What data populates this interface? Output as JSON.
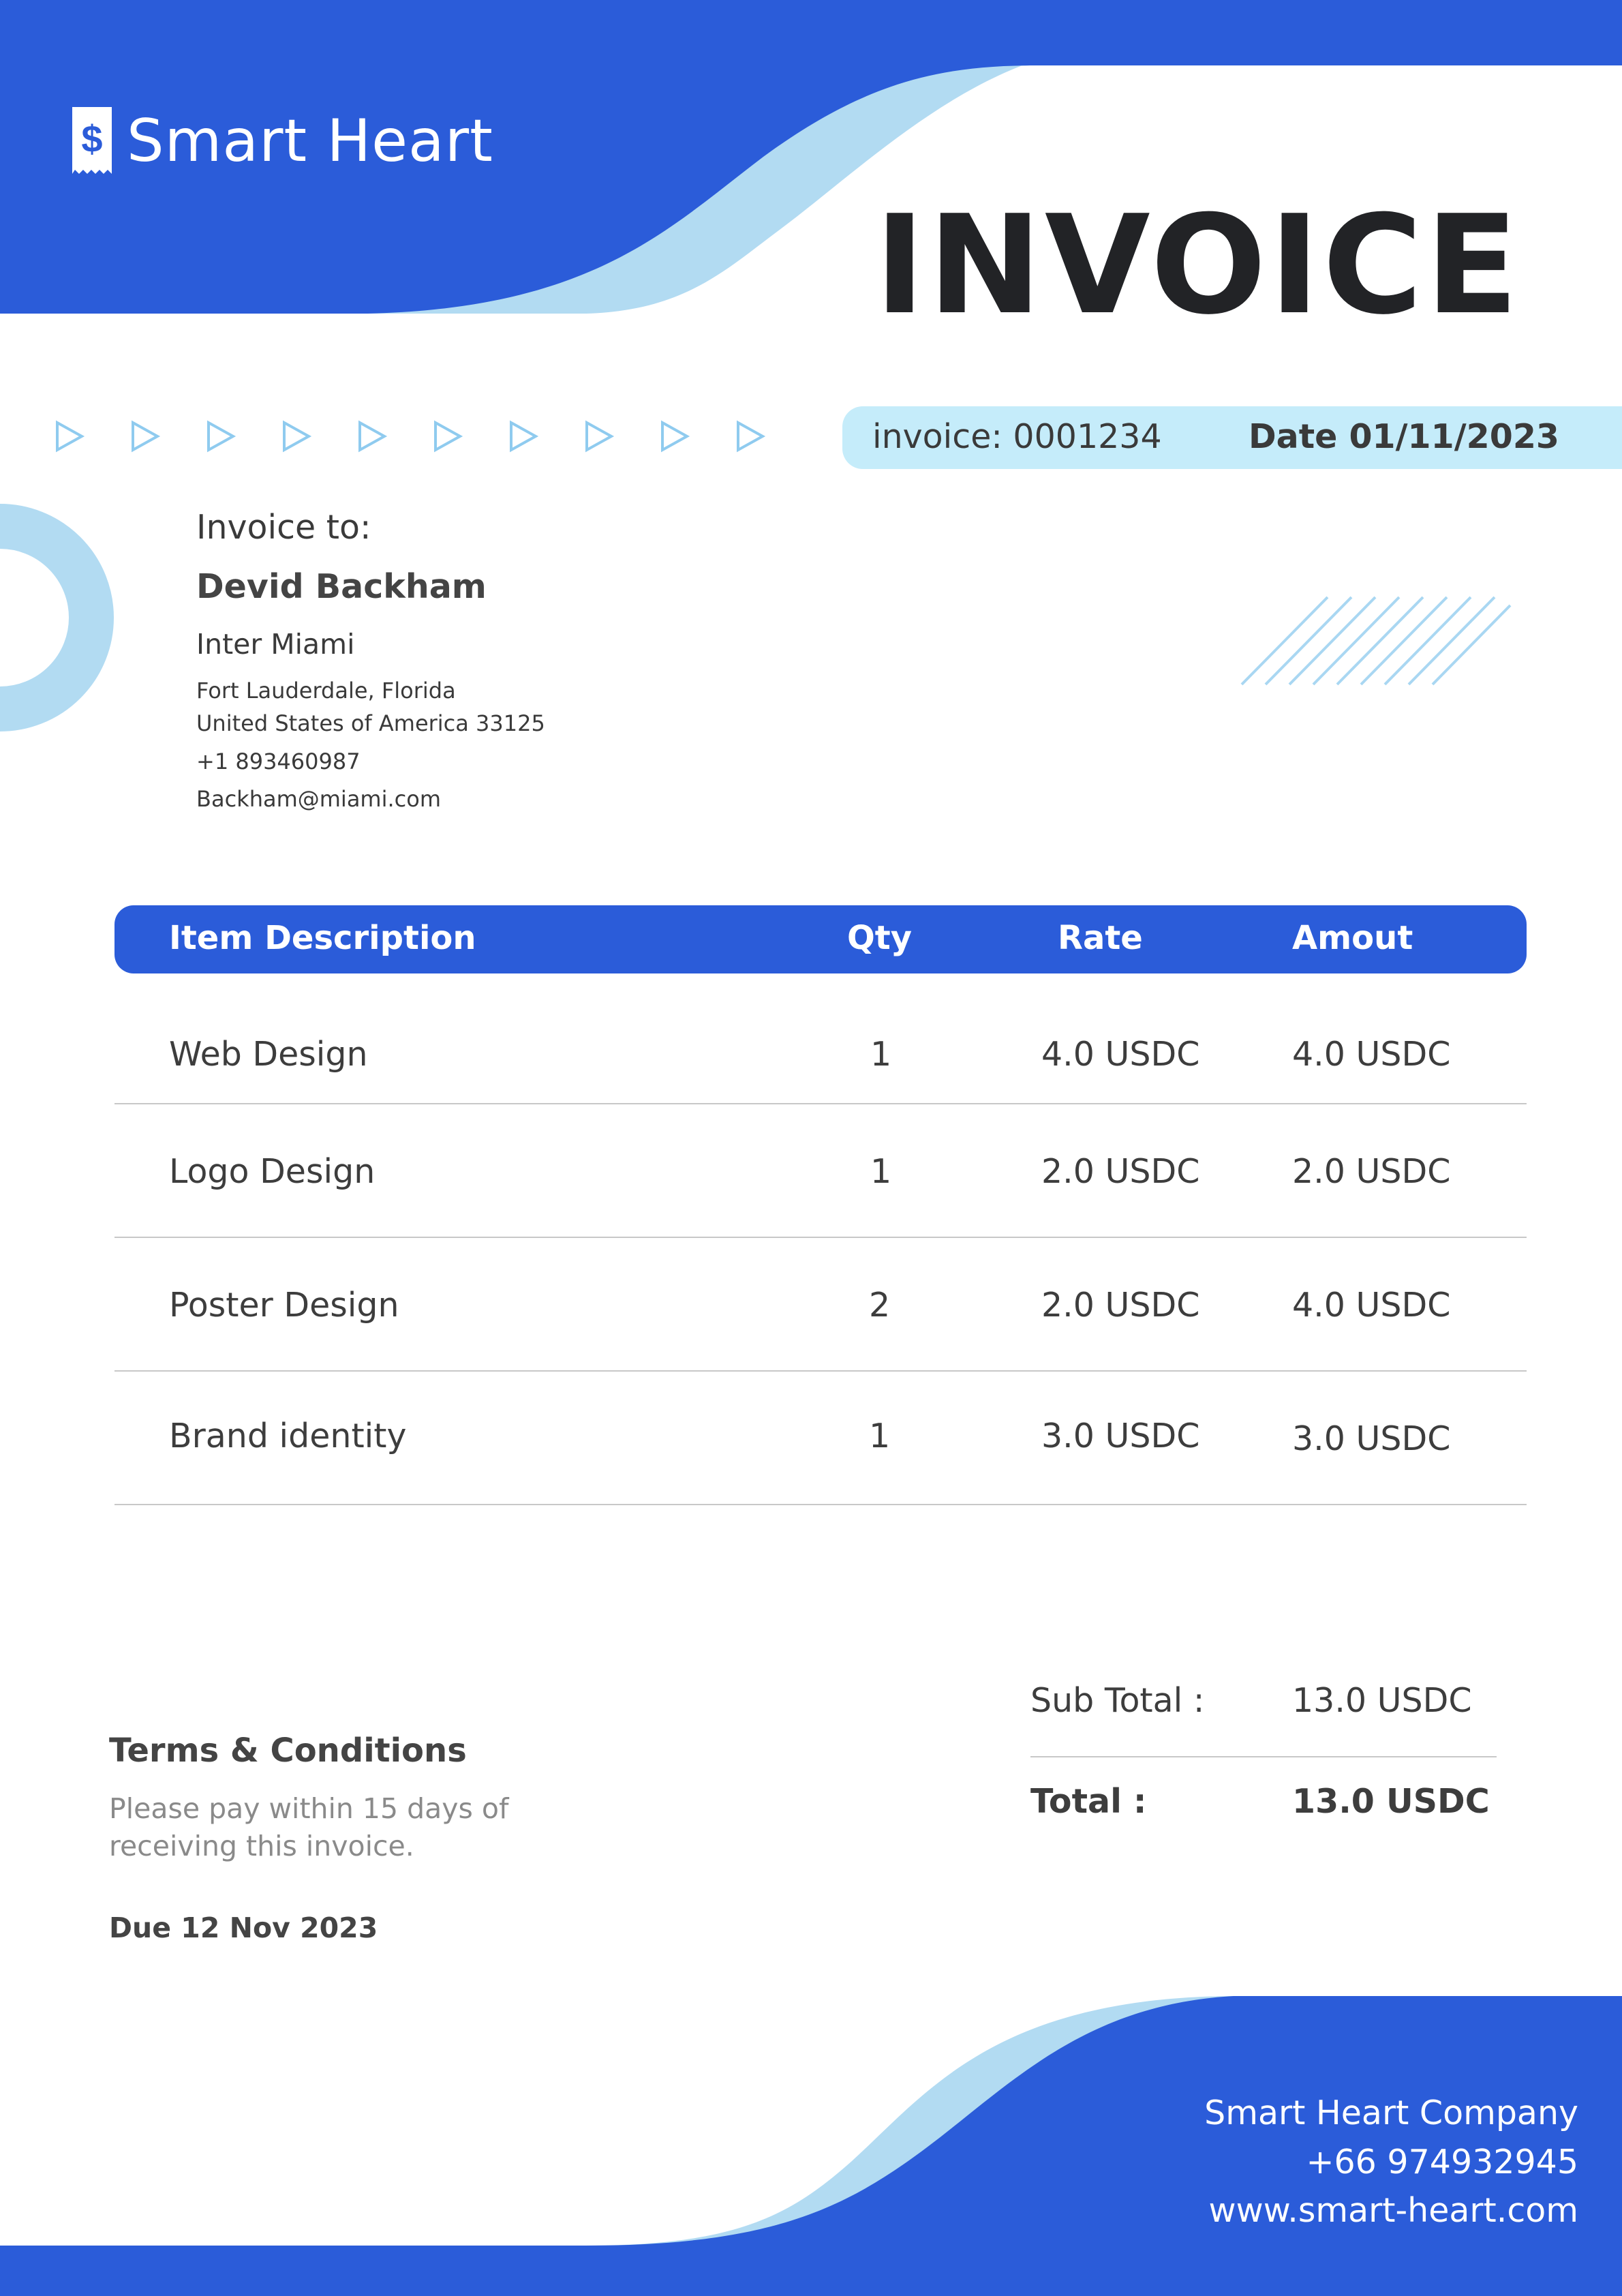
{
  "brand": {
    "name": "Smart Heart",
    "logo_icon": "dollar-receipt-icon",
    "logo_glyph": "$"
  },
  "colors": {
    "primary_blue": "#2B5CD9",
    "light_blue": "#B2DBF2",
    "pill_blue": "#C5ECFA",
    "title_dark": "#222326"
  },
  "document": {
    "title": "INVOICE",
    "invoice_number": "invoice: 0001234",
    "date": "Date 01/11/2023"
  },
  "bill_to": {
    "label": "Invoice to:",
    "name": "Devid Backham",
    "company": "Inter Miami",
    "address_line1": "Fort Lauderdale, Florida",
    "address_line2": "United States of America 33125",
    "phone": "+1 893460987",
    "email": "Backham@miami.com"
  },
  "table": {
    "headers": {
      "description": "Item Description",
      "qty": "Qty",
      "rate": "Rate",
      "amount": "Amout"
    },
    "rows": [
      {
        "description": "Web Design",
        "qty": "1",
        "rate": "4.0 USDC",
        "amount": "4.0 USDC"
      },
      {
        "description": "Logo Design",
        "qty": "1",
        "rate": "2.0 USDC",
        "amount": "2.0 USDC"
      },
      {
        "description": "Poster Design",
        "qty": "2",
        "rate": "2.0 USDC",
        "amount": "4.0 USDC"
      },
      {
        "description": "Brand identity",
        "qty": "1",
        "rate": "3.0 USDC",
        "amount": "3.0 USDC"
      }
    ]
  },
  "terms": {
    "title": "Terms & Conditions",
    "text": "Please pay within 15 days of receiving this invoice.",
    "due": "Due 12 Nov 2023"
  },
  "totals": {
    "subtotal_label": "Sub Total :",
    "subtotal_value": "13.0 USDC",
    "total_label": "Total :",
    "total_value": "13.0 USDC"
  },
  "footer": {
    "company": "Smart Heart Company",
    "phone": "+66 974932945",
    "website": "www.smart-heart.com"
  }
}
